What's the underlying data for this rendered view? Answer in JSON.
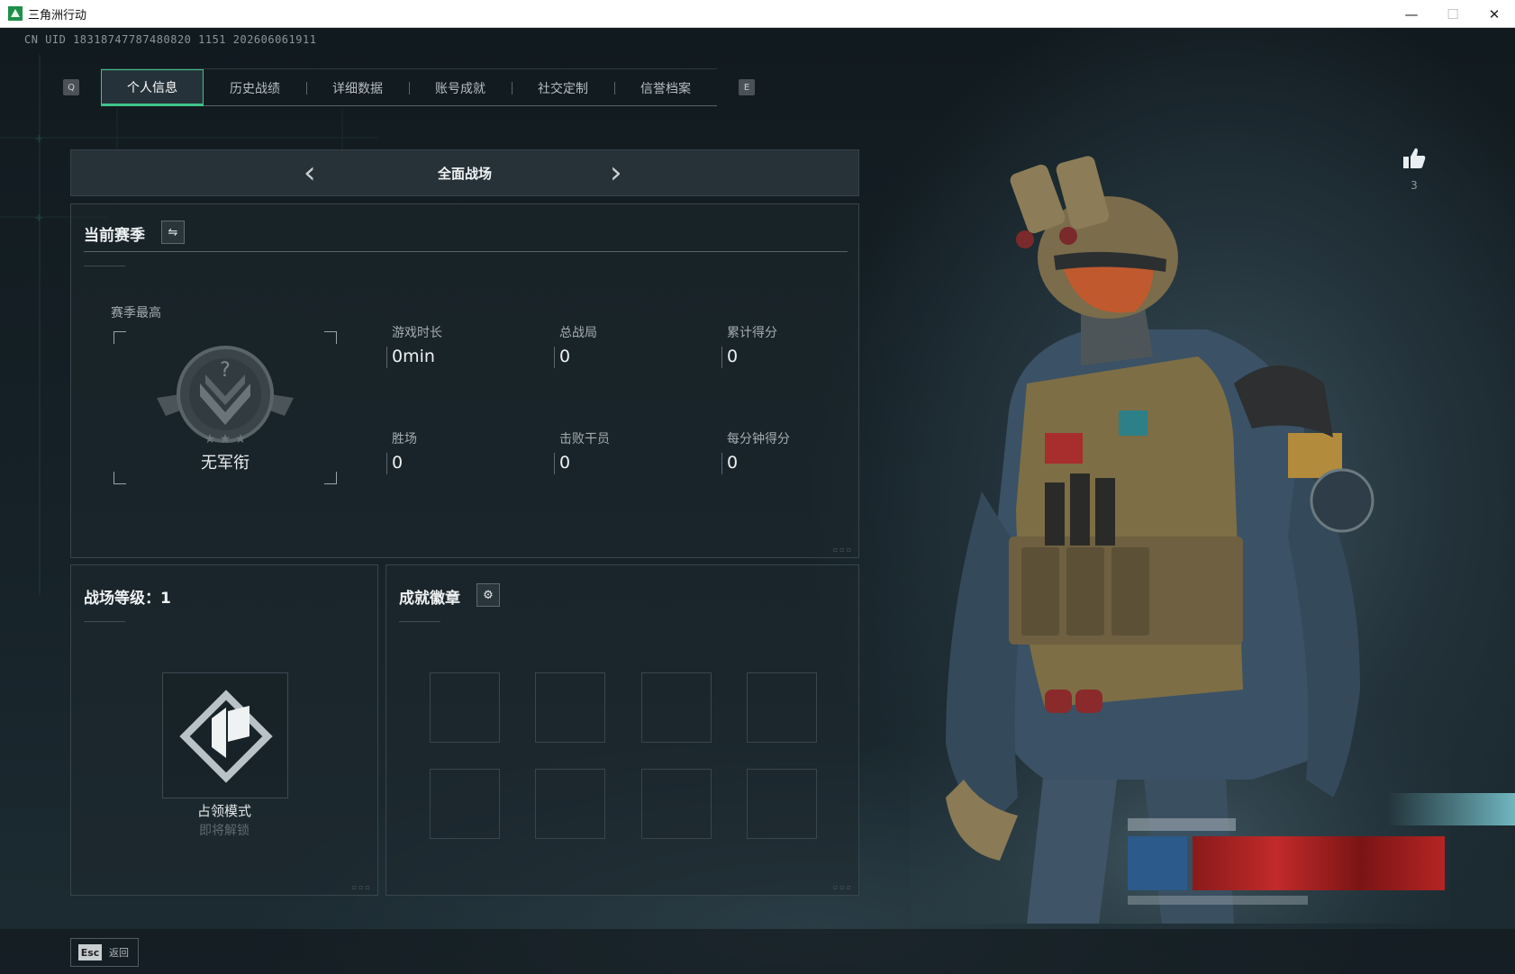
{
  "window": {
    "title": "三角洲行动",
    "minimize": "—",
    "maximize": "☐",
    "close": "✕"
  },
  "uid": "CN UID 18318747787480820 1151 202606061911",
  "tabs": {
    "prev_key": "Q",
    "next_key": "E",
    "items": [
      {
        "label": "个人信息",
        "active": true
      },
      {
        "label": "历史战绩",
        "active": false
      },
      {
        "label": "详细数据",
        "active": false
      },
      {
        "label": "账号成就",
        "active": false
      },
      {
        "label": "社交定制",
        "active": false
      },
      {
        "label": "信誉档案",
        "active": false
      }
    ]
  },
  "mode": {
    "title": "全面战场",
    "prev_arrow": "‹",
    "next_arrow": "›"
  },
  "season": {
    "title": "当前赛季",
    "switch_icon": "⇋",
    "best_label": "赛季最高",
    "rank_name": "无军衔",
    "stats": [
      {
        "label": "游戏时长",
        "value": "0min"
      },
      {
        "label": "总战局",
        "value": "0"
      },
      {
        "label": "累计得分",
        "value": "0"
      },
      {
        "label": "胜场",
        "value": "0"
      },
      {
        "label": "击败干员",
        "value": "0"
      },
      {
        "label": "每分钟得分",
        "value": "0"
      }
    ]
  },
  "level": {
    "title": "战场等级：1",
    "mode_name": "占领模式",
    "mode_status": "即将解锁"
  },
  "badges": {
    "title": "成就徽章",
    "settings_icon": "⚙",
    "slot_count": 8
  },
  "likes": {
    "count": "3"
  },
  "footer": {
    "esc_key": "Esc",
    "esc_label": "返回"
  },
  "colors": {
    "accent": "#3fc48a",
    "panel_border": "#38454c",
    "background": "#0e1519"
  }
}
